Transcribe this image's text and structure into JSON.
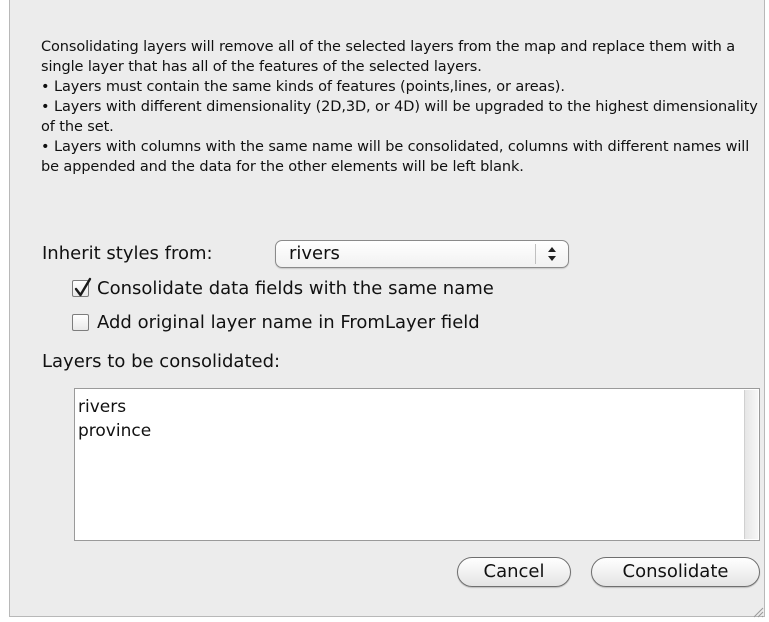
{
  "description": {
    "paragraph1": "Consolidating layers will remove all of the selected layers from the map and replace them with a single layer that has all of the features of the selected layers.",
    "bullet1": "• Layers must contain the same kinds of features (points,lines, or areas).",
    "bullet2": "• Layers with different dimensionality (2D,3D, or 4D) will be upgraded to the highest dimensionality of the set.",
    "bullet3": "• Layers with columns with the same name will be consolidated, columns with different names will be appended and the data for the other elements will be left blank."
  },
  "inherit_styles": {
    "label": "Inherit styles from:",
    "selected": "rivers"
  },
  "options": [
    {
      "label": "Consolidate data fields with the same name",
      "checked": true
    },
    {
      "label": "Add original layer name in FromLayer field",
      "checked": false
    }
  ],
  "layers": {
    "label": "Layers to be consolidated:",
    "items": [
      "rivers",
      "province"
    ]
  },
  "buttons": {
    "cancel": "Cancel",
    "consolidate": "Consolidate"
  },
  "icons": {
    "popup_arrows": "up-down-arrows-icon",
    "checkmark": "checkmark-icon",
    "resize": "resize-grip-icon"
  }
}
